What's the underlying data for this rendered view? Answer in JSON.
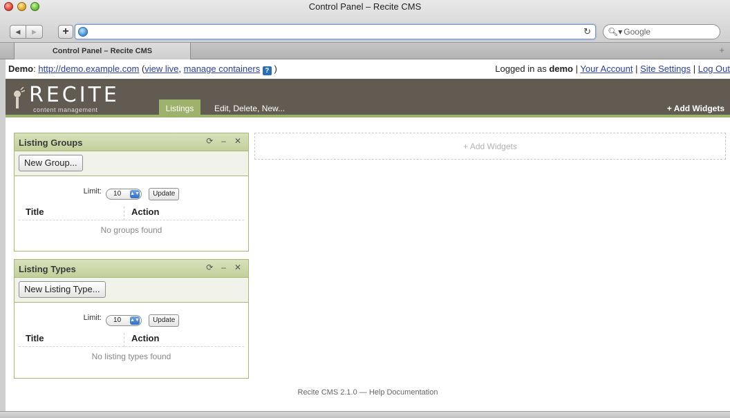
{
  "window": {
    "title": "Control Panel – Recite CMS"
  },
  "browser": {
    "url": "",
    "search_placeholder": "Google",
    "tab_label": "Control Panel – Recite CMS",
    "tab_add": "+"
  },
  "demo_bar": {
    "label": "Demo",
    "url": "http://demo.example.com",
    "view_live": "view live",
    "manage_containers": "manage containers",
    "help_badge": "?",
    "logged_in_prefix": "Logged in as ",
    "username": "demo",
    "your_account": "Your Account",
    "site_settings": "Site Settings",
    "log_out": "Log Out"
  },
  "header": {
    "logo_text": "RECITE",
    "logo_sub": "content management",
    "nav_active": "Listings",
    "nav_link": "Edit, Delete, New...",
    "add_widgets": "+ Add Widgets"
  },
  "widgets": [
    {
      "title": "Listing Groups",
      "button": "New Group...",
      "limit_label": "Limit:",
      "limit_value": "10",
      "update": "Update",
      "columns": [
        "Title",
        "Action"
      ],
      "empty": "No groups found"
    },
    {
      "title": "Listing Types",
      "button": "New Listing Type...",
      "limit_label": "Limit:",
      "limit_value": "10",
      "update": "Update",
      "columns": [
        "Title",
        "Action"
      ],
      "empty": "No listing types found"
    }
  ],
  "dropzone": {
    "label": "+ Add Widgets"
  },
  "footer": {
    "text": "Recite CMS 2.1.0 — Help Documentation"
  },
  "icons": {
    "refresh": "refresh-icon",
    "minimize": "minimize-icon",
    "close": "close-icon"
  },
  "colors": {
    "header_bg": "#625b51",
    "accent_green": "#9db26b",
    "widget_head": "#c3cf9a"
  }
}
